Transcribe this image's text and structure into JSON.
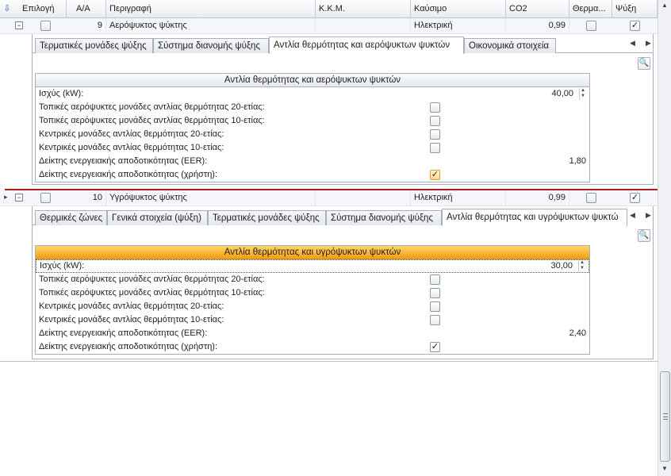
{
  "columns": [
    "Επιλογή",
    "Α/Α",
    "Περιγραφή",
    "Κ.Κ.Μ.",
    "Καύσιμο",
    "CO2",
    "Θερμα...",
    "Ψύξη"
  ],
  "rows": [
    {
      "index": "9",
      "description": "Αερόψυκτος ψύκτης",
      "kkm": "",
      "fuel": "Ηλεκτρική",
      "co2": "0,99",
      "expand": "−",
      "cooling_check": "✓"
    },
    {
      "index": "10",
      "description": "Υγρόψυκτος ψύκτης",
      "kkm": "",
      "fuel": "Ηλεκτρική",
      "co2": "0,99",
      "expand": "−",
      "cooling_check": "✓"
    }
  ],
  "detail1": {
    "tabs": [
      "Τερματικές μονάδες ψύξης",
      "Σύστημα διανομής ψύξης",
      "Αντλία θερμότητας και αερόψυκτων ψυκτών",
      "Οικονομικά στοιχεία"
    ],
    "nav_left": "◀",
    "nav_right": "▶",
    "find_icon": "🔍",
    "form_title": "Αντλία θερμότητας και αερόψυκτων ψυκτών",
    "power_label": "Ισχύς (kW):",
    "power_value": "40,00",
    "labels": [
      "Τοπικές αερόψυκτες μονάδες αντλίας θερμότητας 20-ετίας:",
      "Τοπικές αερόψυκτες μονάδες αντλίας θερμότητας 10-ετίας:",
      "Κεντρικές μονάδες αντλίας θερμότητας 20-ετίας:",
      "Κεντρικές μονάδες αντλίας θερμότητας 10-ετίας:"
    ],
    "eer_label": "Δείκτης ενεργειακής αποδοτικότητας (EER):",
    "eer_value": "1,80",
    "user_label": "Δείκτης ενεργειακής αποδοτικότητας (χρήστη):",
    "user_check": "✓"
  },
  "detail2": {
    "tabs": [
      "Θερμικές ζώνες",
      "Γενικά στοιχεία (ψύξη)",
      "Τερματικές μονάδες ψύξης",
      "Σύστημα διανομής ψύξης",
      "Αντλία θερμότητας και υγρόψυκτων ψυκτώ"
    ],
    "nav_left": "◀",
    "nav_right": "▶",
    "find_icon": "🔍",
    "form_title": "Αντλία θερμότητας και υγρόψυκτων ψυκτών",
    "power_label": "Ισχύς (kW):",
    "power_value": "30,00",
    "labels": [
      "Τοπικές αερόψυκτες μονάδες αντλίας θερμότητας 20-ετίας:",
      "Τοπικές αερόψυκτες μονάδες αντλίας θερμότητας 10-ετίας:",
      "Κεντρικές μονάδες αντλίας θερμότητας 20-ετίας:",
      "Κεντρικές μονάδες αντλίας θερμότητας 10-ετίας:"
    ],
    "eer_label": "Δείκτης ενεργειακής αποδοτικότητας (EER):",
    "eer_value": "2,40",
    "user_label": "Δείκτης ενεργειακής αποδοτικότητας (χρήστη):",
    "user_check": "✓"
  },
  "icons": {
    "sort": "sort-arrow-icon",
    "row_indicator": "▸",
    "scroll_up": "▲",
    "scroll_down": "▼",
    "spin_up": "▲",
    "spin_down": "▼"
  },
  "colors": {
    "accent_orange": "#f39c12",
    "separator_red": "#b01d1d"
  }
}
